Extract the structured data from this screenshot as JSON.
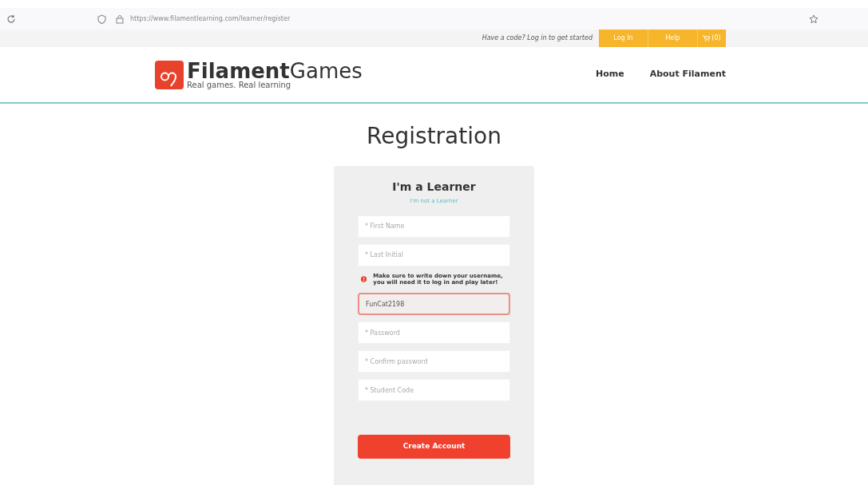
{
  "browser": {
    "url": "https://www.filamentlearning.com/learner/register"
  },
  "top_bar": {
    "prompt": "Have a code? Log in to get started",
    "buttons": [
      "Log In",
      "Help"
    ],
    "cart": "(0)"
  },
  "header": {
    "logo": {
      "brand_bold": "Filament",
      "brand_rest": "Games",
      "tagline": "Real games. Real learning"
    },
    "nav": [
      "Home",
      "About Filament"
    ]
  },
  "page_title": "Registration",
  "card": {
    "title": "I'm a Learner",
    "switch_link": "I'm not a Learner",
    "fields": [
      {
        "placeholder": "* First Name",
        "error": false
      },
      {
        "placeholder": "* Last Initial",
        "error": false
      },
      {
        "kind": "notice",
        "text": "Make sure to write down your username, you will need it to log in and play later!"
      },
      {
        "value": "FunCat2198",
        "error": true
      },
      {
        "placeholder": "* Password",
        "error": false
      },
      {
        "placeholder": "* Confirm password",
        "error": false
      },
      {
        "placeholder": "* Student Code",
        "error": false
      }
    ],
    "submit": "Create Account"
  }
}
